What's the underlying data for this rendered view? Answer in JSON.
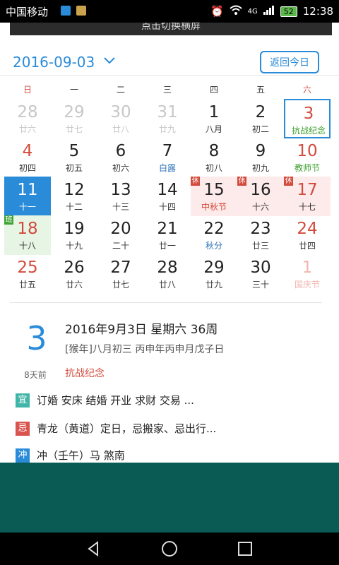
{
  "status": {
    "carrier": "中国移动",
    "network": "4G",
    "battery": "52",
    "time": "12:38"
  },
  "banner": {
    "text": "点击切换横屏"
  },
  "header": {
    "date": "2016-09-03",
    "today_button": "返回今日"
  },
  "weekdays": [
    "日",
    "一",
    "二",
    "三",
    "四",
    "五",
    "六"
  ],
  "calendar": [
    {
      "day": "28",
      "sub": "廿六",
      "style": "faded"
    },
    {
      "day": "29",
      "sub": "廿七",
      "style": "faded"
    },
    {
      "day": "30",
      "sub": "廿八",
      "style": "faded"
    },
    {
      "day": "31",
      "sub": "廿九",
      "style": "faded"
    },
    {
      "day": "1",
      "sub": "八月",
      "style": ""
    },
    {
      "day": "2",
      "sub": "初二",
      "style": ""
    },
    {
      "day": "3",
      "sub": "抗战纪念",
      "style": "red green today"
    },
    {
      "day": "4",
      "sub": "初四",
      "style": "red"
    },
    {
      "day": "5",
      "sub": "初五",
      "style": ""
    },
    {
      "day": "6",
      "sub": "初六",
      "style": ""
    },
    {
      "day": "7",
      "sub": "白露",
      "style": "blue"
    },
    {
      "day": "8",
      "sub": "初八",
      "style": ""
    },
    {
      "day": "9",
      "sub": "初九",
      "style": ""
    },
    {
      "day": "10",
      "sub": "教师节",
      "style": "red green"
    },
    {
      "day": "11",
      "sub": "十一",
      "style": "selected"
    },
    {
      "day": "12",
      "sub": "十二",
      "style": ""
    },
    {
      "day": "13",
      "sub": "十三",
      "style": ""
    },
    {
      "day": "14",
      "sub": "十四",
      "style": ""
    },
    {
      "day": "15",
      "sub": "中秋节",
      "style": "rest redsub",
      "badge": "休"
    },
    {
      "day": "16",
      "sub": "十六",
      "style": "rest",
      "badge": "休"
    },
    {
      "day": "17",
      "sub": "十七",
      "style": "red rest",
      "badge": "休"
    },
    {
      "day": "18",
      "sub": "十八",
      "style": "red work",
      "badge": "班"
    },
    {
      "day": "19",
      "sub": "十九",
      "style": ""
    },
    {
      "day": "20",
      "sub": "二十",
      "style": ""
    },
    {
      "day": "21",
      "sub": "廿一",
      "style": ""
    },
    {
      "day": "22",
      "sub": "秋分",
      "style": "blue"
    },
    {
      "day": "23",
      "sub": "廿三",
      "style": ""
    },
    {
      "day": "24",
      "sub": "廿四",
      "style": "red"
    },
    {
      "day": "25",
      "sub": "廿五",
      "style": "red"
    },
    {
      "day": "26",
      "sub": "廿六",
      "style": ""
    },
    {
      "day": "27",
      "sub": "廿七",
      "style": ""
    },
    {
      "day": "28",
      "sub": "廿八",
      "style": ""
    },
    {
      "day": "29",
      "sub": "廿九",
      "style": ""
    },
    {
      "day": "30",
      "sub": "三十",
      "style": ""
    },
    {
      "day": "1",
      "sub": "国庆节",
      "style": "redfaded"
    }
  ],
  "detail": {
    "big_day": "3",
    "ago": "8天前",
    "line1": "2016年9月3日 星期六 36周",
    "line2": "[猴年]八月初三 丙申年丙申月戊子日",
    "festival": "抗战纪念",
    "yi_label": "宜",
    "yi_text": "订婚 安床 结婚 开业 求财 交易 ...",
    "ji_label": "忌",
    "ji_text": "青龙（黄道）定日，忌搬家、忌出行...",
    "chong_label": "冲",
    "chong_text": "冲（壬午）马 煞南"
  }
}
